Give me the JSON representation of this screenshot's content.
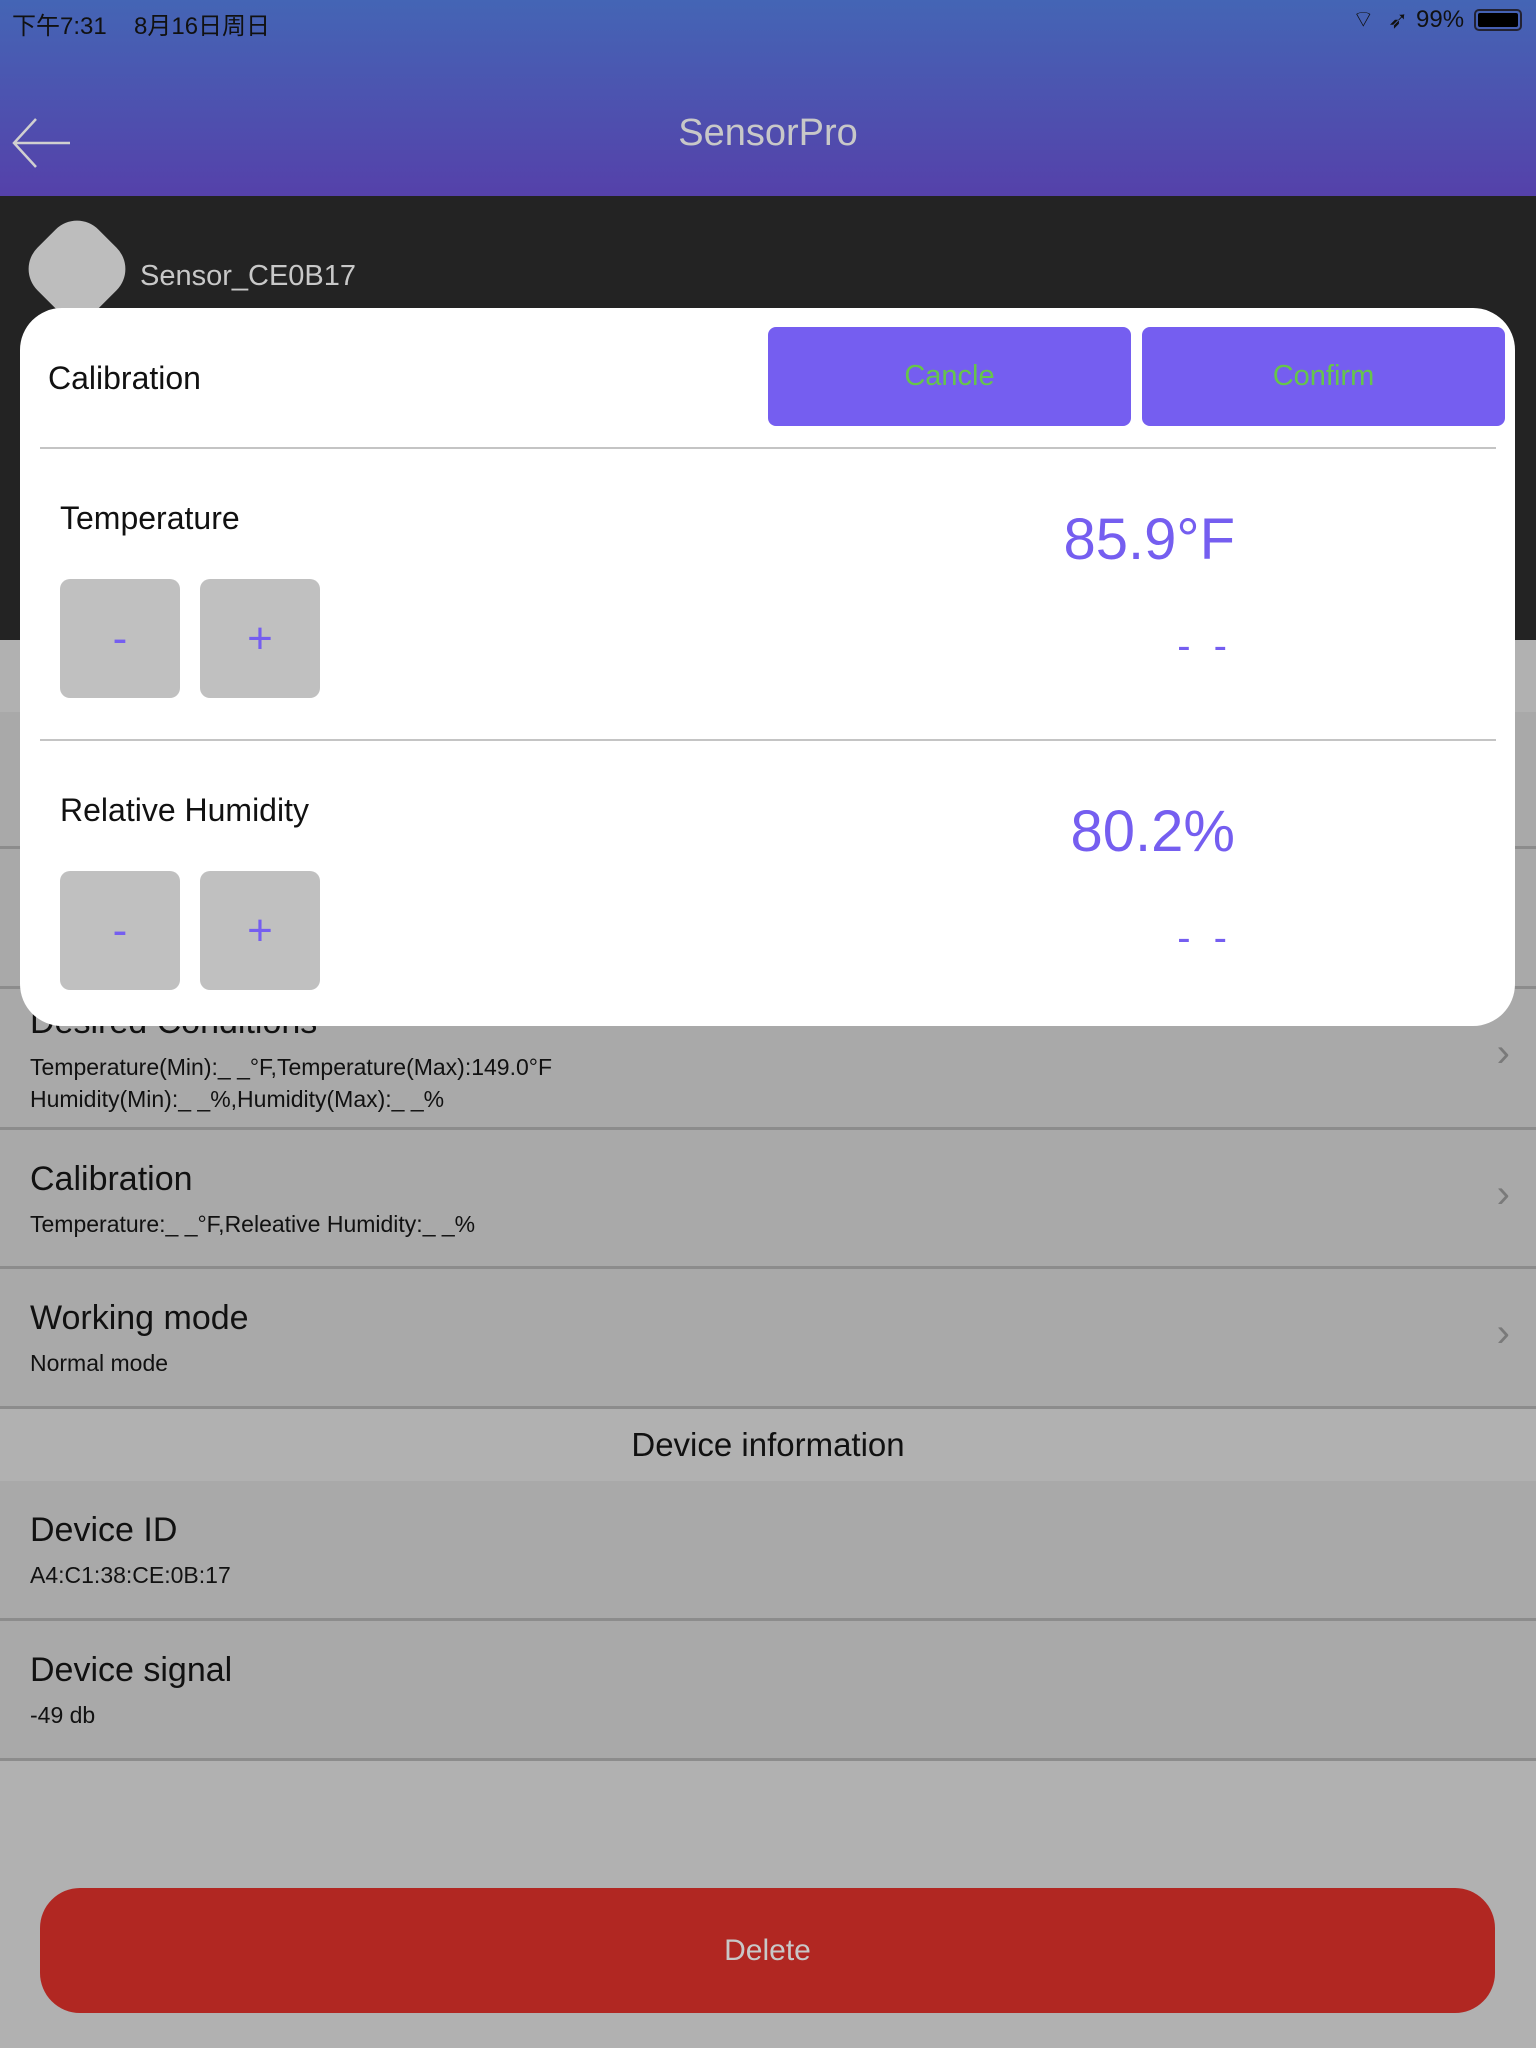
{
  "status_bar": {
    "time": "下午7:31",
    "date": "8月16日周日",
    "battery": "99%"
  },
  "header": {
    "title": "SensorPro"
  },
  "device": {
    "name": "Sensor_CE0B17"
  },
  "rows": [
    {
      "title": "Desired Conditions",
      "sub1": "Temperature(Min):_ _°F,Temperature(Max):149.0°F",
      "sub2": "Humidity(Min):_ _%,Humidity(Max):_ _%"
    },
    {
      "title": "Calibration",
      "sub1": "Temperature:_ _°F,Releative Humidity:_ _%"
    },
    {
      "title": "Working mode",
      "sub1": "Normal mode"
    }
  ],
  "section_header": "Device information",
  "info_rows": [
    {
      "title": "Device ID",
      "sub1": "A4:C1:38:CE:0B:17"
    },
    {
      "title": "Device signal",
      "sub1": "-49 db"
    }
  ],
  "delete_label": "Delete",
  "modal": {
    "title": "Calibration",
    "cancel": "Cancle",
    "confirm": "Confirm",
    "temperature": {
      "label": "Temperature",
      "value": "85.9°F",
      "offset": "- -",
      "minus": "-",
      "plus": "+"
    },
    "humidity": {
      "label": "Relative Humidity",
      "value": "80.2%",
      "offset": "- -",
      "minus": "-",
      "plus": "+"
    }
  },
  "colors": {
    "accent": "#755ef0",
    "button_text": "#66c54a",
    "delete": "#b12722"
  }
}
